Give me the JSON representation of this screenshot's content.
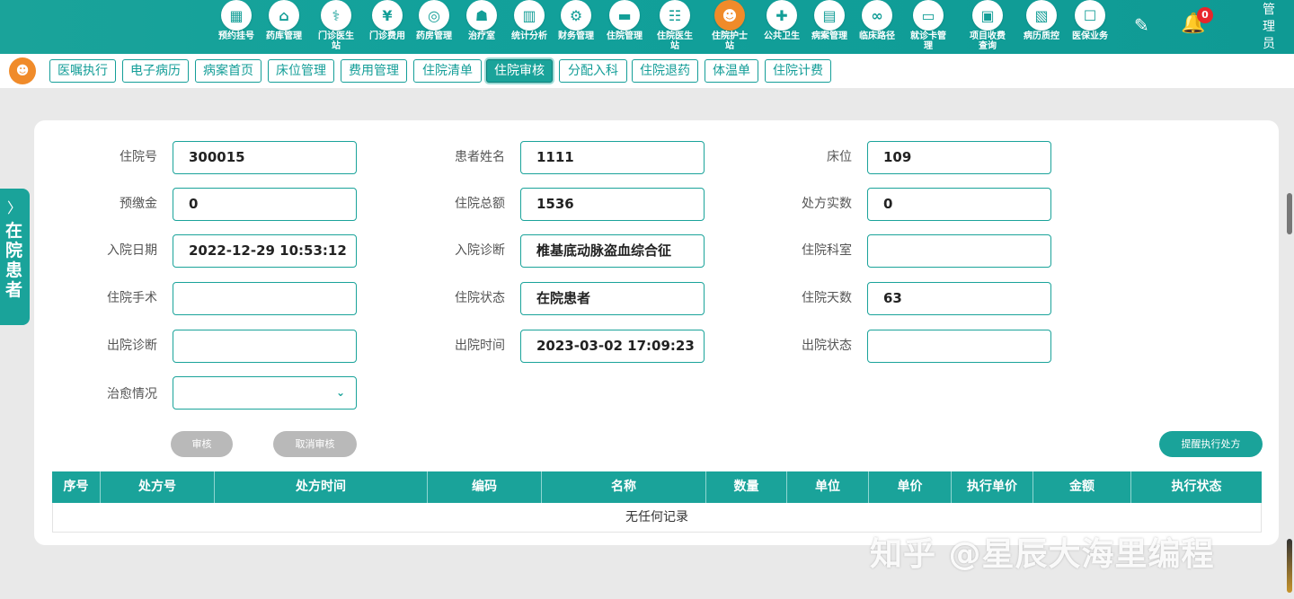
{
  "nav": {
    "items": [
      {
        "label": "预约挂号",
        "icon": "calendar-icon",
        "glyph": "▦"
      },
      {
        "label": "药库管理",
        "icon": "house-icon",
        "glyph": "⌂"
      },
      {
        "label": "门诊医生站",
        "icon": "doctor-icon",
        "glyph": "⚕"
      },
      {
        "label": "门诊费用",
        "icon": "yen-icon",
        "glyph": "¥"
      },
      {
        "label": "药房管理",
        "icon": "pill-icon",
        "glyph": "◎"
      },
      {
        "label": "治疗室",
        "icon": "treatment-icon",
        "glyph": "☗"
      },
      {
        "label": "统计分析",
        "icon": "chart-icon",
        "glyph": "▥"
      },
      {
        "label": "财务管理",
        "icon": "gear-icon",
        "glyph": "⚙"
      },
      {
        "label": "住院管理",
        "icon": "bed-icon",
        "glyph": "▬"
      },
      {
        "label": "住院医生站",
        "icon": "doctor-card-icon",
        "glyph": "☷"
      },
      {
        "label": "住院护士站",
        "icon": "nurse-icon",
        "glyph": "☻"
      },
      {
        "label": "公共卫生",
        "icon": "public-health-icon",
        "glyph": "✚"
      },
      {
        "label": "病案管理",
        "icon": "record-icon",
        "glyph": "▤"
      },
      {
        "label": "临床路径",
        "icon": "path-icon",
        "glyph": "∞"
      },
      {
        "label": "就诊卡管理",
        "icon": "card-icon",
        "glyph": "▭"
      },
      {
        "label": "项目收费查询",
        "icon": "fee-icon",
        "glyph": "▣"
      },
      {
        "label": "病历质控",
        "icon": "quality-icon",
        "glyph": "▧"
      },
      {
        "label": "医保业务",
        "icon": "insurance-icon",
        "glyph": "☐"
      }
    ],
    "active_index": 10,
    "edit_glyph": "✎",
    "bell_glyph": "🔔",
    "bell_count": "0",
    "user": "管理员"
  },
  "tabs": {
    "home_glyph": "☻",
    "items": [
      "医嘱执行",
      "电子病历",
      "病案首页",
      "床位管理",
      "费用管理",
      "住院清单",
      "住院审核",
      "分配入科",
      "住院退药",
      "体温单",
      "住院计费"
    ],
    "active_index": 6
  },
  "drawer": {
    "chevron": "〉",
    "label": "在院患者"
  },
  "form": {
    "fields": [
      {
        "label": "住院号",
        "value": "300015"
      },
      {
        "label": "患者姓名",
        "value": "1111"
      },
      {
        "label": "床位",
        "value": "109"
      },
      {
        "label": "预缴金",
        "value": "0"
      },
      {
        "label": "住院总额",
        "value": "1536"
      },
      {
        "label": "处方实数",
        "value": "0"
      },
      {
        "label": "入院日期",
        "value": "2022-12-29 10:53:12"
      },
      {
        "label": "入院诊断",
        "value": "椎基底动脉盗血综合征"
      },
      {
        "label": "住院科室",
        "value": ""
      },
      {
        "label": "住院手术",
        "value": ""
      },
      {
        "label": "住院状态",
        "value": "在院患者"
      },
      {
        "label": "住院天数",
        "value": "63"
      },
      {
        "label": "出院诊断",
        "value": ""
      },
      {
        "label": "出院时间",
        "value": "2023-03-02 17:09:23"
      },
      {
        "label": "出院状态",
        "value": ""
      }
    ],
    "cure": {
      "label": "治愈情况",
      "value": "",
      "chevron": "⌄"
    }
  },
  "buttons": {
    "audit": "审核",
    "cancel_audit": "取消审核",
    "remind": "提醒执行处方"
  },
  "table": {
    "columns": [
      "序号",
      "处方号",
      "处方时间",
      "编码",
      "名称",
      "数量",
      "单位",
      "单价",
      "执行单价",
      "金额",
      "执行状态"
    ],
    "empty_text": "无任何记录"
  },
  "watermark": "知乎 @星辰大海里编程"
}
